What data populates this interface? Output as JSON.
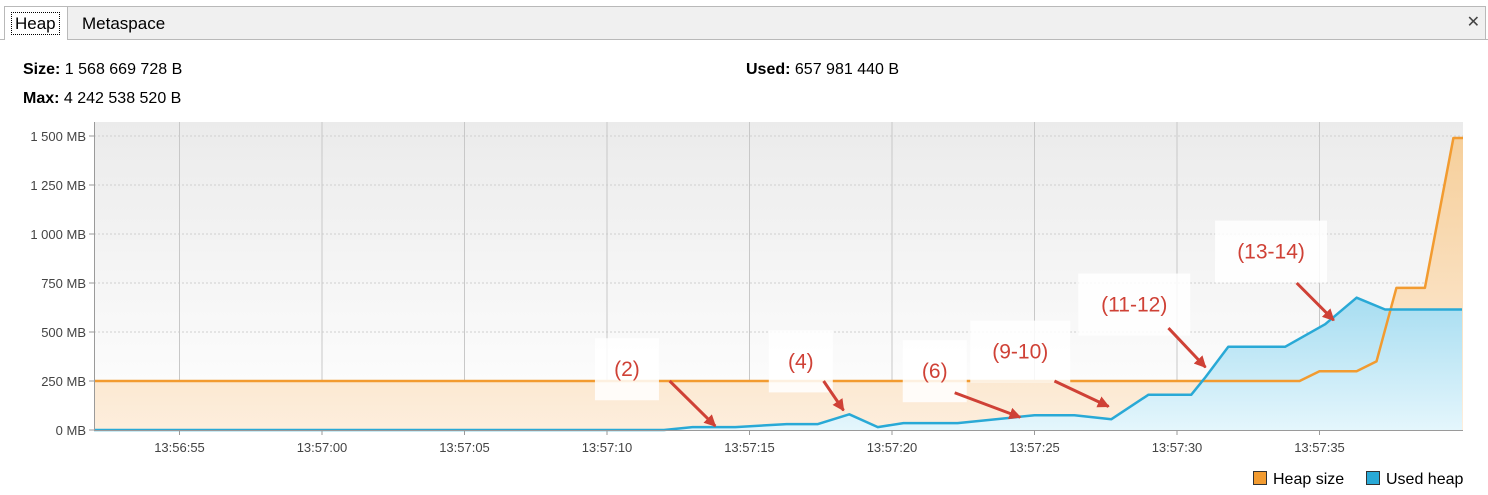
{
  "tabs": [
    {
      "label": "Heap",
      "active": true
    },
    {
      "label": "Metaspace",
      "active": false
    }
  ],
  "close_icon": "close-icon",
  "info": {
    "size_label": "Size:",
    "size_value": "1 568 669 728 B",
    "max_label": "Max:",
    "max_value": "4 242 538 520 B",
    "used_label": "Used:",
    "used_value": "657 981 440 B"
  },
  "colors": {
    "heap_size": "#f29b30",
    "used_heap": "#29a9d6",
    "annotation": "#cf4136"
  },
  "chart_data": {
    "type": "area",
    "y_unit": "MB",
    "ylim": [
      0,
      1550
    ],
    "y_ticks": [
      0,
      250,
      500,
      750,
      1000,
      1250,
      1500
    ],
    "y_tick_labels": [
      "0 MB",
      "250 MB",
      "500 MB",
      "750 MB",
      "1 000 MB",
      "1 250 MB",
      "1 500 MB"
    ],
    "xlim": [
      "13:56:52",
      "13:57:40"
    ],
    "x_tick_labels": [
      "13:56:55",
      "13:57:00",
      "13:57:05",
      "13:57:10",
      "13:57:15",
      "13:57:20",
      "13:57:25",
      "13:57:30",
      "13:57:35"
    ],
    "grid": true,
    "legend_position": "bottom-right",
    "series": [
      {
        "name": "Heap size",
        "color": "#f29b30",
        "points": [
          [
            "13:56:52",
            250
          ],
          [
            "13:57:34.3",
            250
          ],
          [
            "13:57:35",
            300
          ],
          [
            "13:57:36.3",
            300
          ],
          [
            "13:57:37",
            350
          ],
          [
            "13:57:37.7",
            725
          ],
          [
            "13:57:38.7",
            725
          ],
          [
            "13:57:39.7",
            1490
          ],
          [
            "13:57:42",
            1490
          ]
        ]
      },
      {
        "name": "Used heap",
        "color": "#29a9d6",
        "points": [
          [
            "13:56:52",
            0
          ],
          [
            "13:57:12",
            0
          ],
          [
            "13:57:13",
            15
          ],
          [
            "13:57:14.5",
            15
          ],
          [
            "13:57:16.3",
            30
          ],
          [
            "13:57:17.4",
            30
          ],
          [
            "13:57:18.5",
            80
          ],
          [
            "13:57:19.5",
            15
          ],
          [
            "13:57:20.4",
            35
          ],
          [
            "13:57:22.3",
            35
          ],
          [
            "13:57:25",
            75
          ],
          [
            "13:57:26.4",
            75
          ],
          [
            "13:57:27.7",
            55
          ],
          [
            "13:57:29",
            180
          ],
          [
            "13:57:30.5",
            180
          ],
          [
            "13:57:31",
            270
          ],
          [
            "13:57:31.8",
            425
          ],
          [
            "13:57:33.8",
            425
          ],
          [
            "13:57:35.2",
            540
          ],
          [
            "13:57:36.3",
            675
          ],
          [
            "13:57:37.3",
            615
          ],
          [
            "13:57:40",
            615
          ]
        ]
      }
    ],
    "annotations": [
      {
        "text": "(2)",
        "label_at": [
          "13:57:10.7",
          310
        ],
        "arrow_from": [
          "13:57:12.2",
          250
        ],
        "arrow_to": [
          "13:57:13.8",
          20
        ]
      },
      {
        "text": "(4)",
        "label_at": [
          "13:57:16.8",
          350
        ],
        "arrow_from": [
          "13:57:17.6",
          250
        ],
        "arrow_to": [
          "13:57:18.3",
          100
        ]
      },
      {
        "text": "(6)",
        "label_at": [
          "13:57:21.5",
          300
        ],
        "arrow_from": [
          "13:57:22.2",
          190
        ],
        "arrow_to": [
          "13:57:24.5",
          65
        ]
      },
      {
        "text": "(9-10)",
        "label_at": [
          "13:57:24.5",
          400
        ],
        "arrow_from": [
          "13:57:25.7",
          250
        ],
        "arrow_to": [
          "13:57:27.6",
          120
        ]
      },
      {
        "text": "(11-12)",
        "label_at": [
          "13:57:28.5",
          640
        ],
        "arrow_from": [
          "13:57:29.7",
          520
        ],
        "arrow_to": [
          "13:57:31",
          320
        ]
      },
      {
        "text": "(13-14)",
        "label_at": [
          "13:57:33.3",
          910
        ],
        "arrow_from": [
          "13:57:34.2",
          750
        ],
        "arrow_to": [
          "13:57:35.5",
          560
        ]
      }
    ]
  }
}
